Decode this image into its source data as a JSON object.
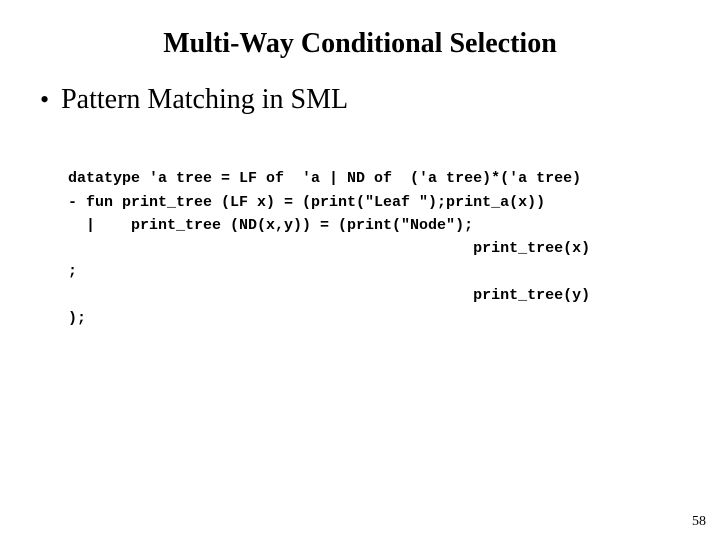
{
  "title": "Multi-Way Conditional Selection",
  "bullet": "Pattern Matching in SML",
  "code": {
    "l1": "datatype 'a tree = LF of  'a | ND of  ('a tree)*('a tree)",
    "l2": "- fun print_tree (LF x) = (print(\"Leaf \");print_a(x))",
    "l3": "  |    print_tree (ND(x,y)) = (print(\"Node\");",
    "l4": "                                             print_tree(x)",
    "l5": ";",
    "l6": "                                             print_tree(y)",
    "l7": ");"
  },
  "page": "58"
}
